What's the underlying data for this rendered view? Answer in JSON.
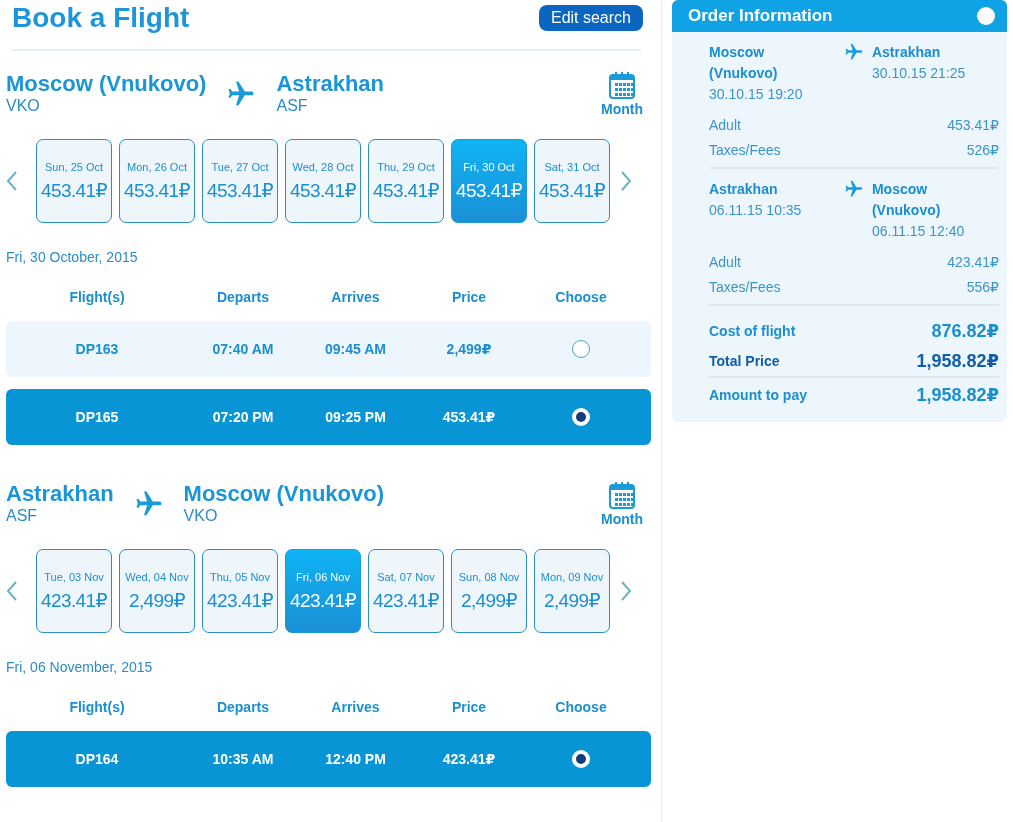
{
  "title": "Book a Flight",
  "edit_button": "Edit search",
  "legs": [
    {
      "from": {
        "city": "Moscow (Vnukovo)",
        "code": "VKO"
      },
      "to": {
        "city": "Astrakhan",
        "code": "ASF"
      },
      "month_label": "Month",
      "dates": [
        {
          "label": "Sun, 25 Oct",
          "price": "453.41₽",
          "selected": false
        },
        {
          "label": "Mon, 26 Oct",
          "price": "453.41₽",
          "selected": false
        },
        {
          "label": "Tue, 27 Oct",
          "price": "453.41₽",
          "selected": false
        },
        {
          "label": "Wed, 28 Oct",
          "price": "453.41₽",
          "selected": false
        },
        {
          "label": "Thu, 29 Oct",
          "price": "453.41₽",
          "selected": false
        },
        {
          "label": "Fri, 30 Oct",
          "price": "453.41₽",
          "selected": true
        },
        {
          "label": "Sat, 31 Oct",
          "price": "453.41₽",
          "selected": false
        }
      ],
      "date_heading": "Fri, 30 October, 2015",
      "columns": [
        "Flight(s)",
        "Departs",
        "Arrives",
        "Price",
        "Choose"
      ],
      "flights": [
        {
          "number": "DP163",
          "departs": "07:40 AM",
          "arrives": "09:45 AM",
          "price": "2,499₽",
          "selected": false
        },
        {
          "number": "DP165",
          "departs": "07:20 PM",
          "arrives": "09:25 PM",
          "price": "453.41₽",
          "selected": true
        }
      ]
    },
    {
      "from": {
        "city": "Astrakhan",
        "code": "ASF"
      },
      "to": {
        "city": "Moscow (Vnukovo)",
        "code": "VKO"
      },
      "month_label": "Month",
      "dates": [
        {
          "label": "Tue, 03 Nov",
          "price": "423.41₽",
          "selected": false
        },
        {
          "label": "Wed, 04 Nov",
          "price": "2,499₽",
          "selected": false
        },
        {
          "label": "Thu, 05 Nov",
          "price": "423.41₽",
          "selected": false
        },
        {
          "label": "Fri, 06 Nov",
          "price": "423.41₽",
          "selected": true
        },
        {
          "label": "Sat, 07 Nov",
          "price": "423.41₽",
          "selected": false
        },
        {
          "label": "Sun, 08 Nov",
          "price": "2,499₽",
          "selected": false
        },
        {
          "label": "Mon, 09 Nov",
          "price": "2,499₽",
          "selected": false
        }
      ],
      "date_heading": "Fri, 06 November, 2015",
      "columns": [
        "Flight(s)",
        "Departs",
        "Arrives",
        "Price",
        "Choose"
      ],
      "flights": [
        {
          "number": "DP164",
          "departs": "10:35 AM",
          "arrives": "12:40 PM",
          "price": "423.41₽",
          "selected": true
        }
      ]
    }
  ],
  "order": {
    "title": "Order Information",
    "segments": [
      {
        "from": "Moscow (Vnukovo)",
        "from_time": "30.10.15 19:20",
        "to": "Astrakhan",
        "to_time": "30.10.15 21:25",
        "lines": [
          {
            "label": "Adult",
            "value": "453.41₽"
          },
          {
            "label": "Taxes/Fees",
            "value": "526₽"
          }
        ]
      },
      {
        "from": "Astrakhan",
        "from_time": "06.11.15 10:35",
        "to": "Moscow (Vnukovo)",
        "to_time": "06.11.15 12:40",
        "lines": [
          {
            "label": "Adult",
            "value": "423.41₽"
          },
          {
            "label": "Taxes/Fees",
            "value": "556₽"
          }
        ]
      }
    ],
    "totals": [
      {
        "kind": "subtotal",
        "label": "Cost of flight",
        "value": "876.82₽"
      },
      {
        "kind": "total",
        "label": "Total Price",
        "value": "1,958.82₽"
      },
      {
        "kind": "due",
        "label": "Amount to pay",
        "value": "1,958.82₽"
      }
    ]
  }
}
